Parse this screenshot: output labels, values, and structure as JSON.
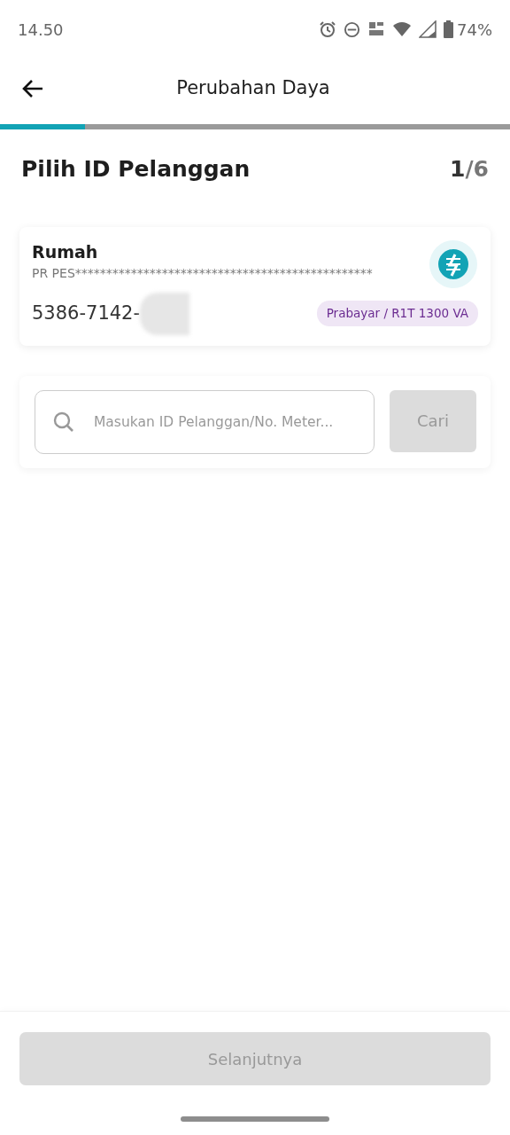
{
  "status_bar": {
    "time": "14.50",
    "battery": "74%"
  },
  "header": {
    "title": "Perubahan Daya"
  },
  "progress": {
    "level": 0.167
  },
  "section": {
    "title": "Pilih ID Pelanggan",
    "step_current": "1",
    "step_total": "/6"
  },
  "customer_card": {
    "name": "Rumah",
    "owner": "PR PES************************************************",
    "id_number": "5386-7142-",
    "tariff": "Prabayar / R1T 1300 VA"
  },
  "search": {
    "placeholder": "Masukan ID Pelanggan/No. Meter...",
    "button": {
      "label": "Cari",
      "disabled": true
    }
  },
  "footer": {
    "button": {
      "label": "Selanjutnya",
      "disabled": true
    }
  }
}
